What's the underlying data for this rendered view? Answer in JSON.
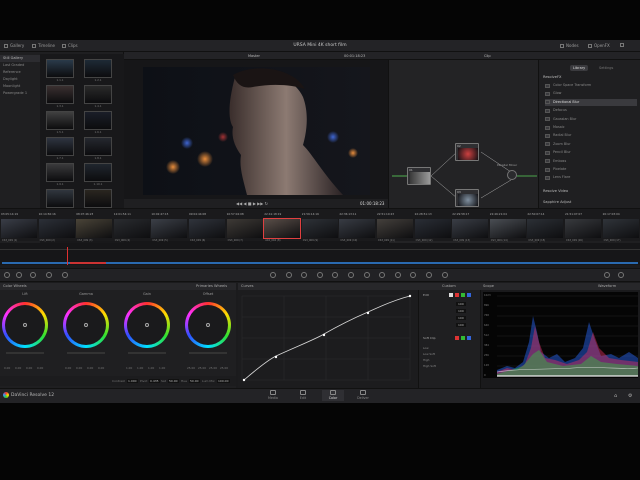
{
  "topbar": {
    "title": "URSA Mini 4K short film",
    "left": [
      "Gallery",
      "Timeline",
      "Clips"
    ],
    "right": [
      "Nodes",
      "OpenFX",
      "Lightbox"
    ]
  },
  "gallery": {
    "albums": [
      "Still Gallery",
      "Last Graded",
      "Reference",
      "Daylight",
      "Moonlight",
      "Powergrade 1"
    ],
    "stills": [
      "1.1.1",
      "1.2.1",
      "1.3.1",
      "1.4.1",
      "1.5.1",
      "1.6.1",
      "1.7.1",
      "1.8.1",
      "1.9.1",
      "1.10.1",
      "1.11.1",
      "1.12.1"
    ]
  },
  "viewer": {
    "title": "Master",
    "timecode": "01:00:18:23",
    "header_tc": "00:01:18:23"
  },
  "nodes": {
    "header": "Clip",
    "labels": [
      "01",
      "02",
      "03",
      "04"
    ],
    "mixer": "Parallel Mixer"
  },
  "library": {
    "tabs": [
      "Library",
      "Settings"
    ],
    "section": "ResolveFX",
    "items": [
      "Color Space Transform",
      "Glow",
      "Directional Blur",
      "Defocus",
      "Gaussian Blur",
      "Mosaic",
      "Radial Blur",
      "Zoom Blur",
      "Pencil Blur",
      "Emboss",
      "Pixelate",
      "Lens Flare"
    ],
    "section2": "Resolve Video",
    "item2": "Sapphire Adjust"
  },
  "clips": [
    {
      "tc": "03:05:14:19",
      "name": "CS3_009 (1)"
    },
    {
      "tc": "10:14:56:16",
      "name": "CS3_009 (2)"
    },
    {
      "tc": "08:07:46:23",
      "name": "CS3_009 (3)"
    },
    {
      "tc": "12:01:54:11",
      "name": "CS3_009 (4)"
    },
    {
      "tc": "10:02:47:15",
      "name": "CS3_009 (5)"
    },
    {
      "tc": "09:04:44:08",
      "name": "CS3_009 (6)"
    },
    {
      "tc": "10:57:04:08",
      "name": "CS3_009 (7)"
    },
    {
      "tc": "22:41:18:19",
      "name": "A16_004 (8)"
    },
    {
      "tc": "21:56:14:16",
      "name": "CS3_009 (9)"
    },
    {
      "tc": "22:36:13:11",
      "name": "CS3_009 (10)"
    },
    {
      "tc": "22:51:10:23",
      "name": "CS3_009 (11)"
    },
    {
      "tc": "22:28:51:13",
      "name": "CS3_009 (12)"
    },
    {
      "tc": "22:29:58:17",
      "name": "CS3_009 (13)"
    },
    {
      "tc": "22:46:21:04",
      "name": "CS3_009 (14)"
    },
    {
      "tc": "22:50:07:14",
      "name": "CS3_009 (15)"
    },
    {
      "tc": "21:51:07:07",
      "name": "CS3_009 (16)"
    },
    {
      "tc": "20:17:03:04",
      "name": "CS3_009 (17)"
    }
  ],
  "color_wheels": {
    "title": "Color Wheels",
    "mode": "Primaries Wheels",
    "wheels": [
      "Lift",
      "Gamma",
      "Gain",
      "Offset"
    ],
    "values": [
      [
        "0.00",
        "0.00",
        "0.00",
        "0.00"
      ],
      [
        "0.00",
        "0.00",
        "0.00",
        "0.00"
      ],
      [
        "1.00",
        "1.00",
        "1.00",
        "1.00"
      ],
      [
        "25.00",
        "25.00",
        "25.00",
        "25.00"
      ]
    ],
    "footer": {
      "contrast_label": "Contrast",
      "contrast": "1.000",
      "pivot_label": "Pivot",
      "pivot": "0.435",
      "sat_label": "Sat",
      "sat": "50.00",
      "hue_label": "Hue",
      "hue": "50.00",
      "lum_label": "Lum Mix",
      "lum": "100.00"
    }
  },
  "curves": {
    "title": "Curves"
  },
  "custom": {
    "title": "Custom",
    "edit": "Edit",
    "soft_clip": "Soft Clip",
    "values": [
      "100",
      "100",
      "100",
      "100"
    ],
    "low": "Low",
    "high": "High",
    "low_soft": "Low Soft",
    "high_soft": "High Soft"
  },
  "scope": {
    "title": "Scope",
    "mode": "Waveform",
    "ticks": [
      "1023",
      "896",
      "768",
      "640",
      "512",
      "384",
      "256",
      "128",
      "0"
    ]
  },
  "pages": [
    "Media",
    "Edit",
    "Color",
    "Deliver"
  ],
  "active_page": "Color",
  "brand": "DaVinci Resolve 12"
}
